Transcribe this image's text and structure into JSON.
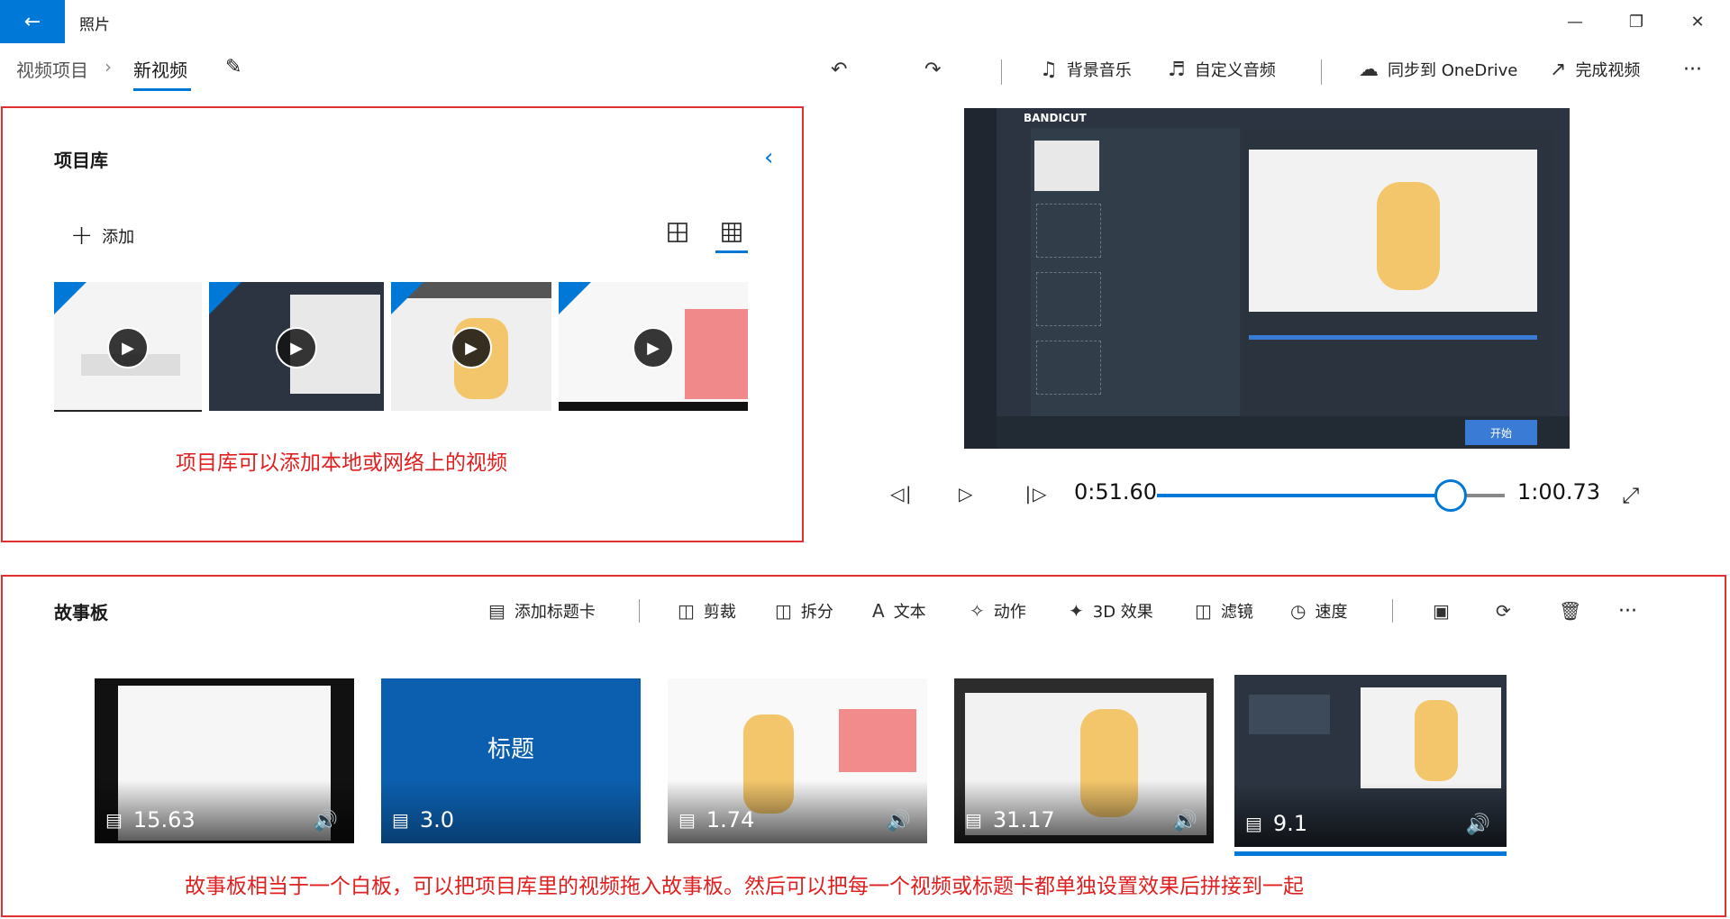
{
  "app": {
    "title": "照片",
    "back_icon": "arrow-left-icon"
  },
  "window_controls": {
    "minimize": "—",
    "maximize": "❐",
    "close": "✕"
  },
  "breadcrumb": {
    "parent": "视频项目",
    "separator": "›",
    "current": "新视频"
  },
  "header_actions": {
    "undo_icon": "↶",
    "redo_icon": "↷",
    "bg_music": "背景音乐",
    "custom_audio": "自定义音频",
    "sync": "同步到 OneDrive",
    "finish": "完成视频",
    "more": "···"
  },
  "library": {
    "title": "项目库",
    "collapse_icon": "‹",
    "add_label": "添加",
    "note": "项目库可以添加本地或网络上的视频"
  },
  "player": {
    "current_time": "0:51.60",
    "total_time": "1:00.73",
    "progress": 0.845
  },
  "preview": {
    "brand": "BANDICUT",
    "start_label": "开始"
  },
  "storyboard": {
    "title": "故事板",
    "tools": {
      "add_title_card": "添加标题卡",
      "trim": "剪裁",
      "split": "拆分",
      "text": "文本",
      "motion": "动作",
      "effects_3d": "3D 效果",
      "filters": "滤镜",
      "speed": "速度",
      "more": "···"
    },
    "clips": [
      {
        "duration": "15.63"
      },
      {
        "duration": "3.0",
        "title": "标题"
      },
      {
        "duration": "1.74"
      },
      {
        "duration": "31.17"
      },
      {
        "duration": "9.1"
      }
    ],
    "note": "故事板相当于一个白板，可以把项目库里的视频拖入故事板。然后可以把每一个视频或标题卡都单独设置效果后拼接到一起"
  },
  "colors": {
    "accent": "#0078d7",
    "annotation": "#e02020"
  }
}
